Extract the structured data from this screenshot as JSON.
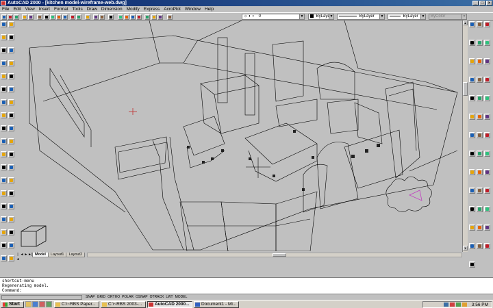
{
  "window": {
    "title": "AutoCAD 2000 - [kitchen model-wireframe-web.dwg]"
  },
  "menu": [
    "File",
    "Edit",
    "View",
    "Insert",
    "Format",
    "Tools",
    "Draw",
    "Dimension",
    "Modify",
    "Express",
    "AcroPlot",
    "Window",
    "Help"
  ],
  "properties_bar": {
    "layer_value": "0",
    "color_value": "ByLayer",
    "linetype_value": "ByLayer",
    "lineweight_value": "ByLayer",
    "plotstyle_value": "ByColor"
  },
  "layout_tabs": [
    "Model",
    "Layout1",
    "Layout2"
  ],
  "active_tab": "Model",
  "command_history": [
    "shortcut-menu",
    "Regenerating model.",
    "Command:"
  ],
  "status_buttons": [
    "SNAP",
    "GRID",
    "ORTHO",
    "POLAR",
    "OSNAP",
    "OTRACK",
    "LWT",
    "MODEL"
  ],
  "taskbar": {
    "start_label": "Start",
    "tasks": [
      "C:\\~RBS Paper...",
      "C:\\~RBS 2003-...",
      "AutoCAD 2000...",
      "Document1 - Mi..."
    ],
    "active_task": "AutoCAD 2000...",
    "clock": "3:56 PM"
  },
  "colors": {
    "title_start": "#0a246a",
    "title_end": "#3a6ea5",
    "viewport_bg": "#c0c0c0",
    "wire": "#000000"
  }
}
